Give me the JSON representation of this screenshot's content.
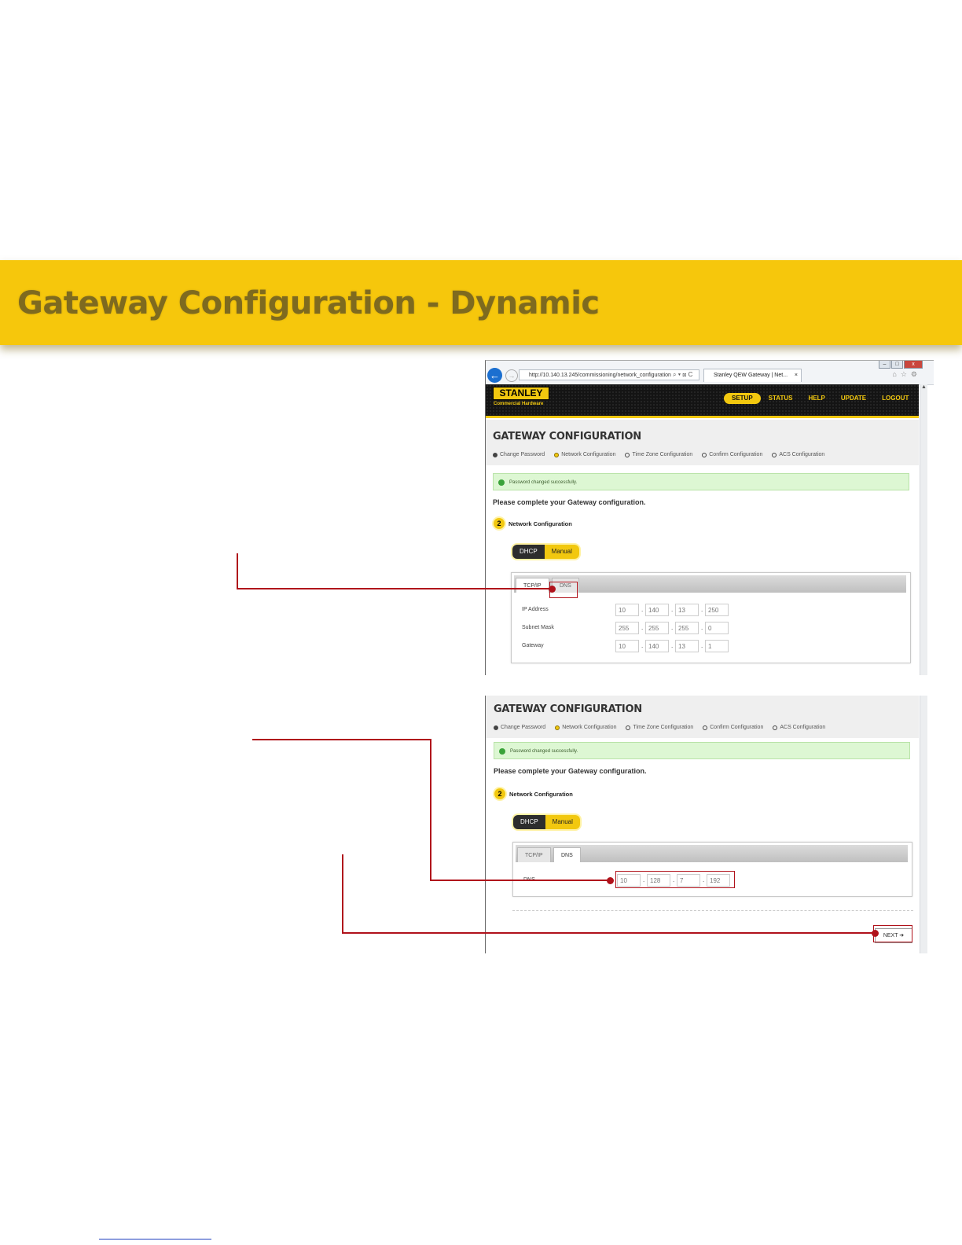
{
  "slide": {
    "title": "Gateway Configuration - Dynamic"
  },
  "browser": {
    "url": "http://10.140.13.245/commissioning/network_configuration",
    "tab_title": "Stanley QEW Gateway | Net...",
    "back_glyph": "←",
    "tab_close_glyph": "×",
    "address_icons": "⌕ ▾ ⊠ C",
    "window_buttons": {
      "minimize": "–",
      "maximize": "□",
      "close": "x"
    },
    "toolbar_icons": "⌂☆⚙"
  },
  "app": {
    "logo": "STANLEY",
    "logo_sub": "Commercial Hardware",
    "nav": [
      "SETUP",
      "STATUS",
      "HELP",
      "UPDATE",
      "LOGOUT"
    ],
    "active_nav": "SETUP",
    "page_title": "GATEWAY CONFIGURATION",
    "steps": [
      "Change Password",
      "Network Configuration",
      "Time Zone Configuration",
      "Confirm Configuration",
      "ACS Configuration"
    ],
    "success_message": "Password changed successfully.",
    "intro": "Please complete your Gateway configuration.",
    "section_number": "2",
    "section_title": "Network Configuration",
    "mode_toggle": {
      "dhcp": "DHCP",
      "manual": "Manual"
    },
    "tabs": {
      "tcpip": "TCP/IP",
      "dns": "DNS"
    },
    "dot": "."
  },
  "screen1": {
    "fields": {
      "ip_label": "IP Address",
      "ip": [
        "10",
        "140",
        "13",
        "250"
      ],
      "mask_label": "Subnet Mask",
      "mask": [
        "255",
        "255",
        "255",
        "0"
      ],
      "gw_label": "Gateway",
      "gw": [
        "10",
        "140",
        "13",
        "1"
      ]
    }
  },
  "screen2": {
    "dns_label": "DNS",
    "dns": [
      "10",
      "128",
      "7",
      "192"
    ],
    "next_label": "NEXT ➜"
  },
  "colors": {
    "banner": "#f6c70c",
    "banner_text": "#7e6a1f",
    "callout": "#b0121b",
    "brand_yellow": "#f2c80f"
  }
}
